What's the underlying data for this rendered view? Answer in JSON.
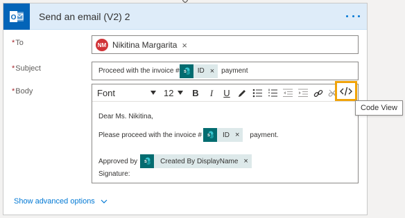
{
  "action": {
    "title": "Send an email (V2) 2",
    "icon": "outlook-icon",
    "accent": "#0364b8"
  },
  "fields": {
    "to": {
      "label": "To",
      "person": {
        "initials": "NM",
        "name": "Nikitina Margarita"
      }
    },
    "subject": {
      "label": "Subject",
      "prefix": "Proceed with the invoice #",
      "token": "ID",
      "suffix": "payment"
    },
    "body": {
      "label": "Body",
      "toolbar": {
        "font": "Font",
        "size": "12",
        "bold": "B",
        "italic": "I",
        "underline": "U"
      },
      "line1": "Dear Ms. Nikitina,",
      "line2_prefix": "Please proceed with the invoice #",
      "line2_token": "ID",
      "line2_suffix": "payment.",
      "line3_prefix": "Approved by",
      "line3_token": "Created By DisplayName",
      "line4": "Signature:"
    }
  },
  "tooltip": "Code View",
  "advanced_options": "Show advanced options",
  "required_mark": "*",
  "token_remove": "×",
  "colors": {
    "header_bg": "#deecf9",
    "link": "#0078d4",
    "sharepoint": "#036c70",
    "highlight": "#f0a30a"
  }
}
